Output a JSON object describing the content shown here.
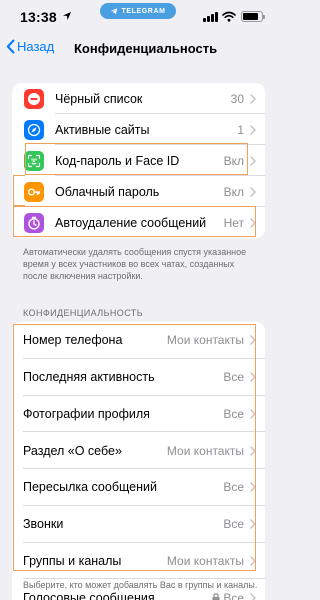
{
  "status_bar": {
    "time": "13:38",
    "app_pill": "TELEGRAM"
  },
  "nav": {
    "back_label": "Назад",
    "title": "Конфиденциальность"
  },
  "security_items": [
    {
      "label": "Чёрный список",
      "value": "30",
      "icon": "blocked-icon",
      "color": "#ff3b30"
    },
    {
      "label": "Активные сайты",
      "value": "1",
      "icon": "compass-icon",
      "color": "#007aff"
    },
    {
      "label": "Код-пароль и Face ID",
      "value": "Вкл",
      "icon": "face-id-icon",
      "color": "#34c759"
    },
    {
      "label": "Облачный пароль",
      "value": "Вкл",
      "icon": "key-icon",
      "color": "#ff9500"
    },
    {
      "label": "Автоудаление сообщений",
      "value": "Нет",
      "icon": "timer-icon",
      "color": "#af52de"
    }
  ],
  "security_footnote": "Автоматически удалять сообщения спустя указанное время у всех участников во всех чатах, созданных после включения настройки.",
  "privacy_section": {
    "header": "КОНФИДЕНЦИАЛЬНОСТЬ",
    "items": [
      {
        "label": "Номер телефона",
        "value": "Мои контакты"
      },
      {
        "label": "Последняя активность",
        "value": "Все"
      },
      {
        "label": "Фотографии профиля",
        "value": "Все"
      },
      {
        "label": "Раздел «О себе»",
        "value": "Мои контакты"
      },
      {
        "label": "Пересылка сообщений",
        "value": "Все"
      },
      {
        "label": "Звонки",
        "value": "Все"
      },
      {
        "label": "Группы и каналы",
        "value": "Мои контакты"
      },
      {
        "label": "Голосовые сообщения",
        "value": "Все",
        "locked": true
      }
    ],
    "footnote": "Выберите, кто может добавлять Вас в группы и каналы."
  },
  "colors": {
    "accent": "#007aff",
    "highlight": "#f0a25a",
    "background": "#efeff4"
  }
}
